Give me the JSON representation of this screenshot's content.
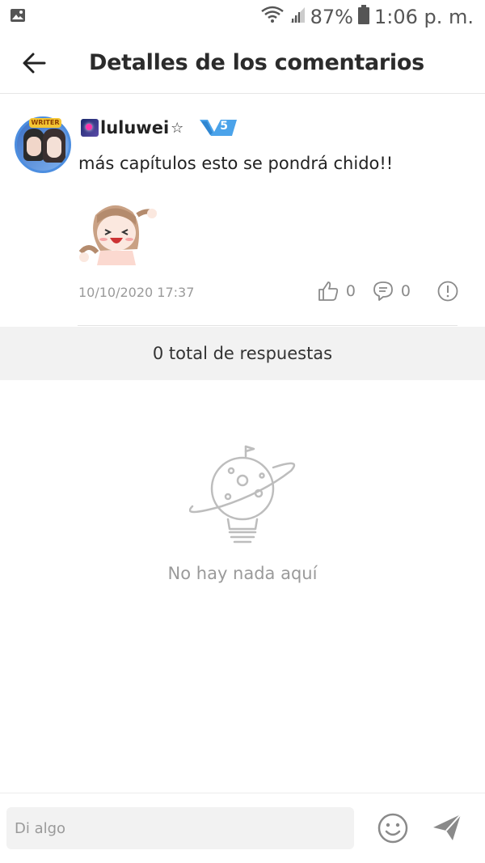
{
  "status_bar": {
    "battery": "87%",
    "time": "1:06 p. m."
  },
  "header": {
    "title": "Detalles de los comentarios"
  },
  "comment": {
    "avatar_badge": "WRITER",
    "username": "luluwei",
    "star": "☆",
    "level": "5",
    "text": "más capítulos esto se pondrá chido!!",
    "timestamp": "10/10/2020 17:37",
    "likes": "0",
    "replies": "0"
  },
  "replies": {
    "summary": "0 total de respuestas"
  },
  "empty_state": {
    "message": "No hay nada aquí"
  },
  "composer": {
    "placeholder": "Di algo"
  },
  "colors": {
    "accent_blue": "#4ba3ea",
    "text_dark": "#222222",
    "text_muted": "#9a9a9a",
    "bar_bg": "#f2f2f2"
  }
}
